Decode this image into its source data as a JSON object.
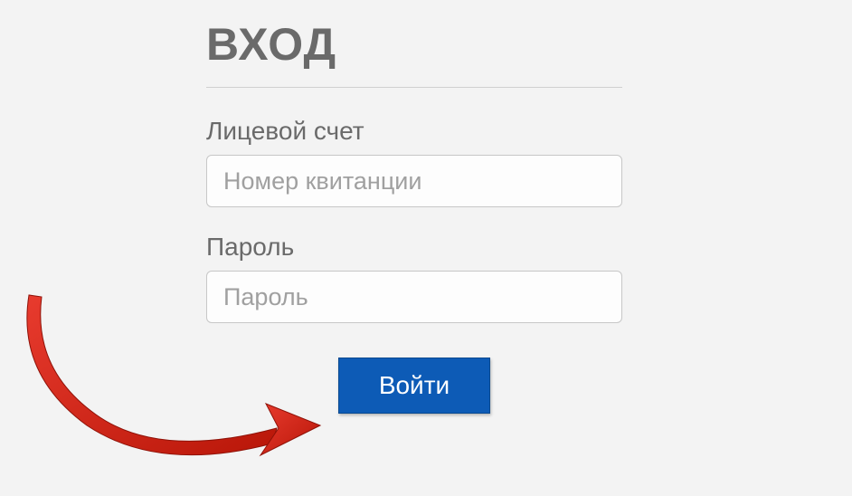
{
  "login": {
    "title": "ВХОД",
    "account": {
      "label": "Лицевой счет",
      "placeholder": "Номер квитанции",
      "value": ""
    },
    "password": {
      "label": "Пароль",
      "placeholder": "Пароль",
      "value": ""
    },
    "submit_label": "Войти"
  },
  "colors": {
    "button_bg": "#0d5bb6",
    "arrow": "#d92a1c"
  }
}
